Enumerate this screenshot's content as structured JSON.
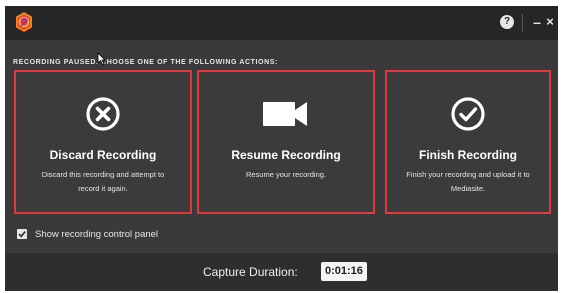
{
  "titlebar": {
    "help_glyph": "?",
    "minimize_glyph": "–",
    "close_glyph": "×",
    "icons": [
      "mediasite-logo-icon",
      "help-icon",
      "minimize-icon",
      "close-icon"
    ]
  },
  "instruction": "RECORDING PAUSED. CHOOSE ONE OF THE FOLLOWING ACTIONS:",
  "cards": [
    {
      "icon": "circle-x-icon",
      "title": "Discard Recording",
      "desc_line1": "Discard this recording and attempt to",
      "desc_line2": "record it again."
    },
    {
      "icon": "video-camera-icon",
      "title": "Resume Recording",
      "desc_line1": "Resume your recording.",
      "desc_line2": ""
    },
    {
      "icon": "circle-check-icon",
      "title": "Finish Recording",
      "desc_line1": "Finish your recording and upload it to",
      "desc_line2": "Mediasite."
    }
  ],
  "options": {
    "show_control_panel_label": "Show recording control panel",
    "show_control_panel_checked": true
  },
  "footer": {
    "duration_label": "Capture Duration:",
    "duration_value": "0:01:16"
  },
  "colors": {
    "window_bg": "#3a3a3a",
    "titlebar_bg": "#262626",
    "footer_bg": "#2e2e2e",
    "card_border": "#e0383b",
    "text": "#e6e6e6"
  }
}
